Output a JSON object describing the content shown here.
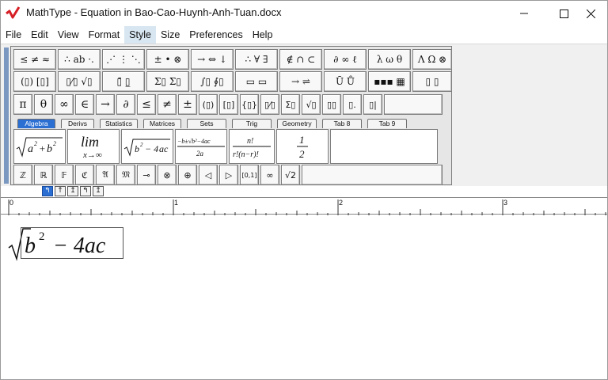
{
  "window": {
    "title": "MathType - Equation in Bao-Cao-Huynh-Anh-Tuan.docx",
    "controls": {
      "minimize": "—",
      "maximize": "☐",
      "close": "✕"
    }
  },
  "menu": [
    {
      "label": "File"
    },
    {
      "label": "Edit"
    },
    {
      "label": "View"
    },
    {
      "label": "Format"
    },
    {
      "label": "Style",
      "active": true
    },
    {
      "label": "Size"
    },
    {
      "label": "Preferences"
    },
    {
      "label": "Help"
    }
  ],
  "palette": {
    "row1": [
      "≤ ≠ ≈",
      "∴ ab ·.",
      "⋰ ⋮ ⋱",
      "± • ⊗",
      "→ ⇔ ↓",
      "∴ ∀ ∃",
      "∉ ∩ ⊂",
      "∂ ∞ ℓ",
      "λ ω θ",
      "Λ Ω ⊗"
    ],
    "row2": [
      "(▯) [▯]",
      "▯⁄▯ √▯",
      "▯̄ ▯̲",
      "Σ▯ Σ▯",
      "∫▯ ∮▯",
      "▭ ▭",
      "→ ⇌",
      "Ū Ů",
      "▪▪▪ ▦",
      "▯ ▯"
    ],
    "row3": [
      "π",
      "θ",
      "∞",
      "∈",
      "→",
      "∂",
      "≤",
      "≠",
      "±",
      "(▯)",
      "[▯]",
      "{▯}",
      "▯⁄▯",
      "Σ▯",
      "√▯",
      "▯▯",
      "▯.",
      "▯|"
    ],
    "tabs": [
      {
        "label": "Algebra",
        "active": true
      },
      {
        "label": "Derivs"
      },
      {
        "label": "Statistics"
      },
      {
        "label": "Matrices"
      },
      {
        "label": "Sets"
      },
      {
        "label": "Trig"
      },
      {
        "label": "Geometry"
      },
      {
        "label": "Tab 8"
      },
      {
        "label": "Tab 9"
      }
    ],
    "templates": [
      "√(a²+b²)",
      "lim x→∞",
      "√(b²−4ac)",
      "(−b±√(b²−4ac))/2a",
      "n!/r!(n−r)!",
      "1/2"
    ],
    "row5": [
      "ℤ",
      "ℝ",
      "𝔽",
      "ℭ",
      "𝔄",
      "𝔐",
      "⊸",
      "⊗",
      "⊕",
      "◁",
      "▷",
      "[0,1]",
      "∞",
      "√2"
    ]
  },
  "align_buttons": [
    {
      "symbol": "↰",
      "active": true
    },
    {
      "symbol": "↑"
    },
    {
      "symbol": "↥"
    },
    {
      "symbol": "↰"
    },
    {
      "symbol": "↥"
    }
  ],
  "ruler": {
    "labels": [
      "0",
      "1",
      "2",
      "3"
    ]
  },
  "equation": {
    "radicand_b": "b",
    "exponent": "2",
    "rest": "− 4ac"
  }
}
